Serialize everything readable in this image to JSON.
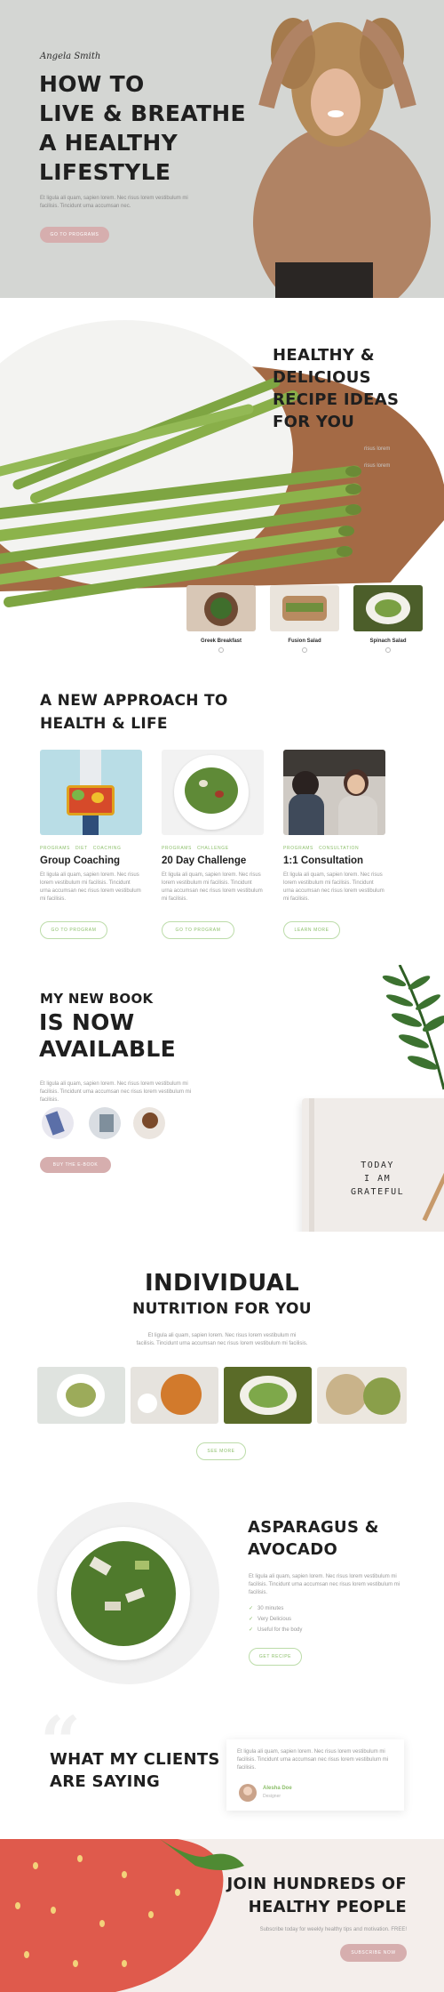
{
  "hero": {
    "signature": "Angela Smith",
    "title_lines": [
      "HOW TO",
      "LIVE & BREATHE",
      "A HEALTHY",
      "LIFESTYLE"
    ],
    "text_line1": "Et ligula ali quam, sapien lorem. Nec risus lorem vestibulum mi",
    "text_line2": "facilisis. Tincidunt urna accumsan nec.",
    "button": "GO TO PROGRAMS"
  },
  "recipes": {
    "title_lines": [
      "HEALTHY &",
      "DELICIOUS",
      "RECIPE IDEAS",
      "FOR YOU"
    ],
    "faded_text_1": "risus lorem",
    "faded_text_2": "risus lorem",
    "items": [
      {
        "label": "Greek Breakfast"
      },
      {
        "label": "Fusion Salad"
      },
      {
        "label": "Spinach Salad"
      }
    ]
  },
  "approach": {
    "title_lines": [
      "A NEW APPROACH TO",
      "HEALTH & LIFE"
    ],
    "cards": [
      {
        "tags": [
          "PROGRAMS",
          "DIET",
          "COACHING"
        ],
        "title": "Group Coaching",
        "text": "Et ligula ali quam, sapien lorem. Nec risus lorem vestibulum mi facilisis. Tincidunt urna accumsan nec risus lorem vestibulum mi facilisis.",
        "button": "GO TO PROGRAM"
      },
      {
        "tags": [
          "PROGRAMS",
          "CHALLENGE"
        ],
        "title": "20 Day Challenge",
        "text": "Et ligula ali quam, sapien lorem. Nec risus lorem vestibulum mi facilisis. Tincidunt urna accumsan nec risus lorem vestibulum mi facilisis.",
        "button": "GO TO PROGRAM"
      },
      {
        "tags": [
          "PROGRAMS",
          "CONSULTATION"
        ],
        "title": "1:1 Consultation",
        "text": "Et ligula ali quam, sapien lorem. Nec risus lorem vestibulum mi facilisis. Tincidunt urna accumsan nec risus lorem vestibulum mi facilisis.",
        "button": "LEARN MORE"
      }
    ]
  },
  "book": {
    "kicker": "MY NEW BOOK",
    "title_lines": [
      "IS NOW",
      "AVAILABLE"
    ],
    "text": "Et ligula ali quam, sapien lorem. Nec risus lorem vestibulum mi facilisis. Tincidunt urna accumsan nec risus lorem vestibulum mi facilisis.",
    "button": "BUY THE E-BOOK",
    "notebook_lines": [
      "TODAY",
      "I AM",
      "GRATEFUL"
    ]
  },
  "nutrition": {
    "title": "INDIVIDUAL",
    "subtitle": "NUTRITION FOR YOU",
    "text_line1": "Et ligula ali quam, sapien lorem. Nec risus lorem vestibulum mi",
    "text_line2": "facilisis. Tincidunt urna accumsan nec risus lorem vestibulum mi facilisis.",
    "button": "SEE MORE"
  },
  "asparagus": {
    "title_lines": [
      "ASPARAGUS &",
      "AVOCADO"
    ],
    "text": "Et ligula ali quam, sapien lorem. Nec risus lorem vestibulum mi facilisis. Tincidunt urna accumsan nec risus lorem vestibulum mi facilisis.",
    "checks": [
      "30 minutes",
      "Very Delicious",
      "Useful for the body"
    ],
    "button": "GET RECIPE"
  },
  "clients": {
    "title_lines": [
      "WHAT MY CLIENTS",
      "ARE SAYING"
    ],
    "quote": "Et ligula ali quam, sapien lorem. Nec risus lorem vestibulum mi facilisis. Tincidunt urna accumsan nec risus lorem vestibulum mi facilisis.",
    "name": "Alesha Doe",
    "role": "Designer"
  },
  "join": {
    "title_lines": [
      "JOIN HUNDREDS OF",
      "HEALTHY PEOPLE"
    ],
    "text": "Subscribe today for weekly healthy tips and motivation. FREE!",
    "button": "SUBSCRIBE NOW"
  },
  "colors": {
    "accent_green": "#8cbf6a",
    "accent_pink": "#d6aeae",
    "hero_bg": "#d4d6d3"
  }
}
